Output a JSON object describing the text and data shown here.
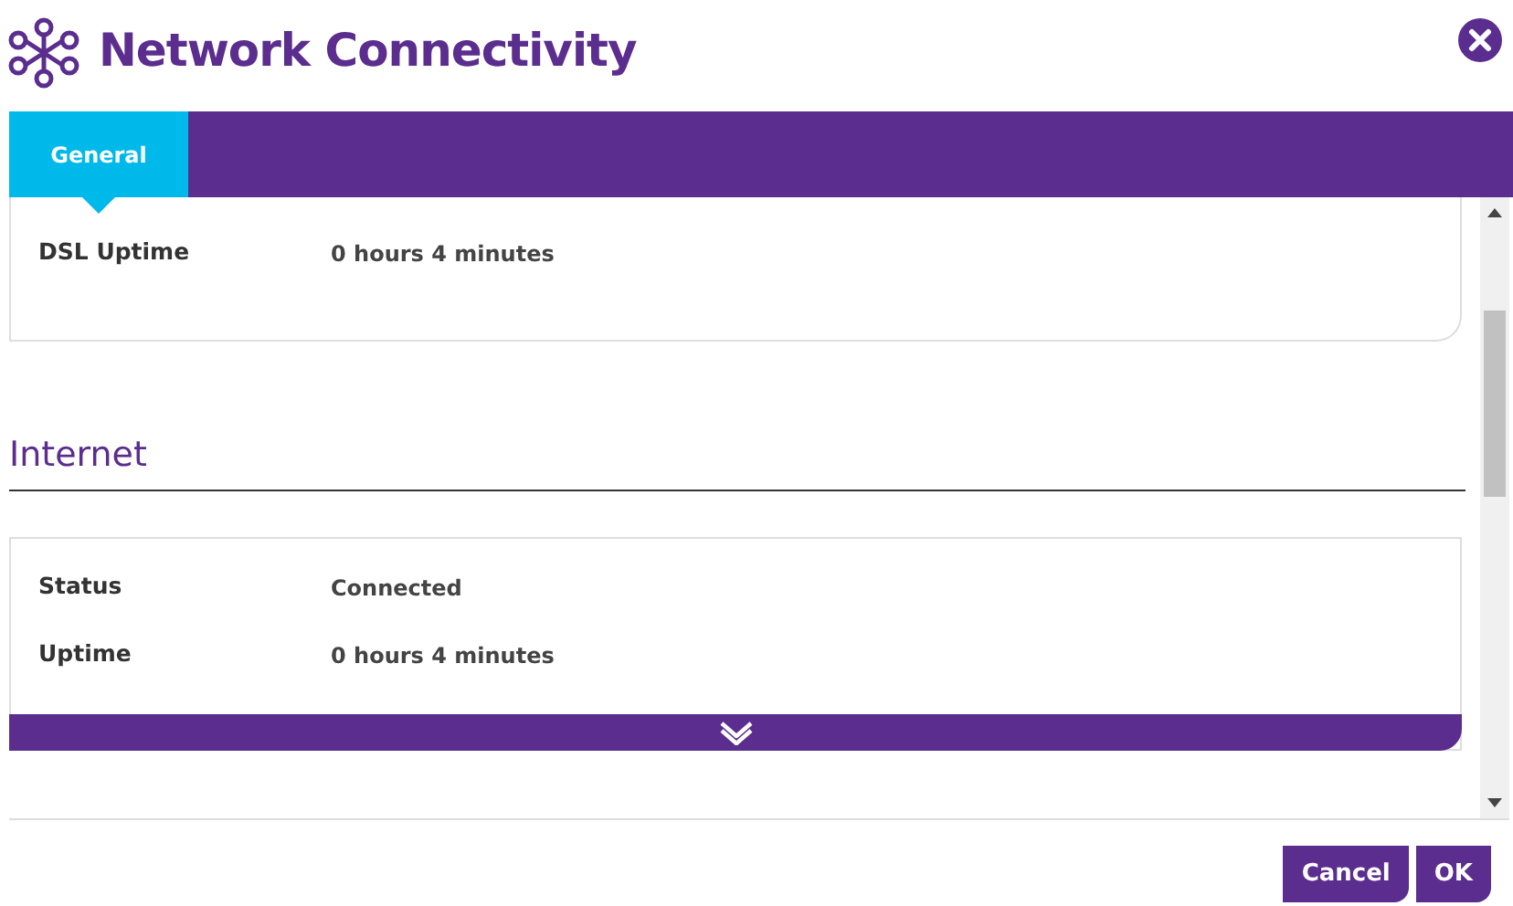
{
  "window": {
    "title": "Network Connectivity"
  },
  "tabs": [
    {
      "label": "General",
      "selected": true
    }
  ],
  "cards": [
    {
      "kind": "plain",
      "rows": [
        {
          "label": "DSL Uptime",
          "value": "0 hours 4 minutes"
        }
      ]
    },
    {
      "kind": "expandable",
      "heading": "Internet",
      "rows": [
        {
          "label": "Status",
          "value": "Connected"
        },
        {
          "label": "Uptime",
          "value": "0 hours 4 minutes"
        }
      ]
    }
  ],
  "buttons": [
    "Cancel",
    "OK"
  ]
}
